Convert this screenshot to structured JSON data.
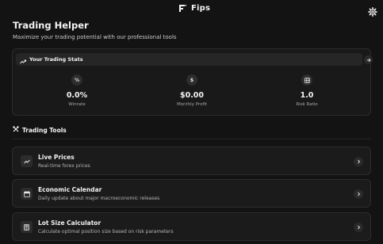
{
  "header": {
    "brand_name": "Fips",
    "logo_icon": "fips-logo-icon",
    "settings_icon": "gear-icon"
  },
  "page": {
    "title": "Trading Helper",
    "subtitle": "Maximize your trading potential with our professional tools"
  },
  "stats": {
    "header_label": "Your Trading Stats",
    "header_icon": "trend-up-icon",
    "items": [
      {
        "icon_glyph": "%",
        "value": "0.0%",
        "label": "Winrate",
        "icon": "percent-icon"
      },
      {
        "icon_glyph": "$",
        "value": "$0.00",
        "label": "Monthly Profit",
        "icon": "dollar-icon"
      },
      {
        "icon_glyph": "",
        "value": "1.0",
        "label": "Risk Ratio",
        "icon": "grid-icon"
      }
    ]
  },
  "tools": {
    "heading": "Trading Tools",
    "heading_icon": "tools-icon",
    "items": [
      {
        "title": "Live Prices",
        "description": "Real-time forex prices",
        "icon": "trend-line-icon"
      },
      {
        "title": "Economic Calendar",
        "description": "Daily update about major macroeconomic releases",
        "icon": "calendar-icon"
      },
      {
        "title": "Lot Size Calculator",
        "description": "Calculate optimal position size based on risk parameters",
        "icon": "calculator-icon"
      }
    ]
  },
  "colors": {
    "background": "#131313",
    "card": "#1b1b1b",
    "text": "#f2f2f2",
    "muted_text": "#b5b5b5"
  }
}
